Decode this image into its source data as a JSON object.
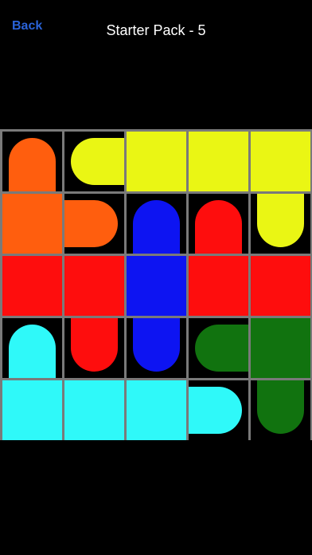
{
  "nav": {
    "back_label": "Back",
    "title": "Starter Pack - 5"
  },
  "colors": {
    "orange": "#ff5e0e",
    "yellow": "#eaf614",
    "blue": "#0d14f2",
    "red": "#fe0d0d",
    "cyan": "#2ff9f9",
    "green": "#11730f",
    "grid_line": "#7a7a7a",
    "empty": "#000000"
  },
  "board": {
    "rows": 5,
    "cols": 5,
    "cells": [
      [
        {
          "color": "orange",
          "shape": "end",
          "dir": "down"
        },
        {
          "color": "yellow",
          "shape": "end",
          "dir": "right"
        },
        {
          "color": "yellow",
          "shape": "full"
        },
        {
          "color": "yellow",
          "shape": "full"
        },
        {
          "color": "yellow",
          "shape": "full"
        }
      ],
      [
        {
          "color": "orange",
          "shape": "full"
        },
        {
          "color": "orange",
          "shape": "end",
          "dir": "left"
        },
        {
          "color": "blue",
          "shape": "end",
          "dir": "down"
        },
        {
          "color": "red",
          "shape": "end",
          "dir": "down"
        },
        {
          "color": "yellow",
          "shape": "end",
          "dir": "up"
        }
      ],
      [
        {
          "color": "red",
          "shape": "full"
        },
        {
          "color": "red",
          "shape": "full"
        },
        {
          "color": "blue",
          "shape": "full"
        },
        {
          "color": "red",
          "shape": "full"
        },
        {
          "color": "red",
          "shape": "full"
        }
      ],
      [
        {
          "color": "cyan",
          "shape": "end",
          "dir": "down"
        },
        {
          "color": "red",
          "shape": "end",
          "dir": "up"
        },
        {
          "color": "blue",
          "shape": "end",
          "dir": "up"
        },
        {
          "color": "green",
          "shape": "end",
          "dir": "right"
        },
        {
          "color": "green",
          "shape": "full"
        }
      ],
      [
        {
          "color": "cyan",
          "shape": "full"
        },
        {
          "color": "cyan",
          "shape": "full"
        },
        {
          "color": "cyan",
          "shape": "full"
        },
        {
          "color": "cyan",
          "shape": "end",
          "dir": "left"
        },
        {
          "color": "green",
          "shape": "end",
          "dir": "up"
        }
      ]
    ]
  }
}
